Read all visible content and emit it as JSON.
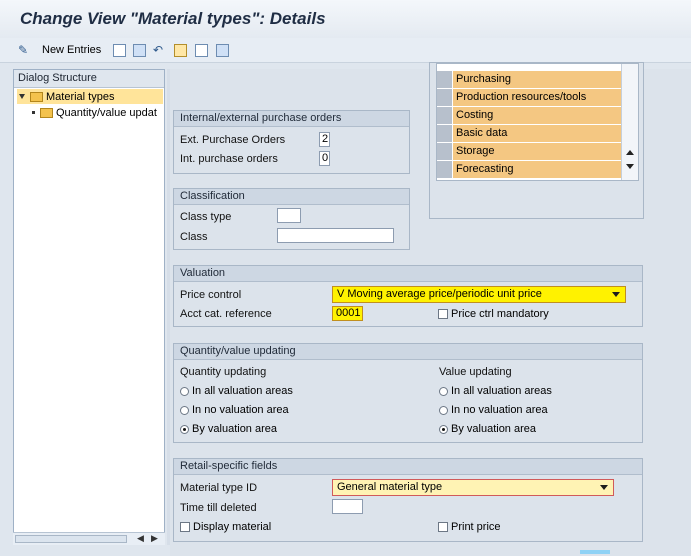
{
  "window": {
    "title": "Change View \"Material types\": Details"
  },
  "toolbar": {
    "new_entries_label": "New Entries"
  },
  "dialog_structure": {
    "header": "Dialog Structure",
    "items": [
      {
        "label": "Material types",
        "selected": true
      },
      {
        "label": "Quantity/value updat",
        "selected": false
      }
    ]
  },
  "views_list": {
    "items": [
      "Purchasing",
      "Production resources/tools",
      "Costing",
      "Basic data",
      "Storage",
      "Forecasting"
    ]
  },
  "purchase_orders": {
    "title": "Internal/external purchase orders",
    "ext_label": "Ext. Purchase Orders",
    "ext_value": "2",
    "int_label": "Int. purchase orders",
    "int_value": "0"
  },
  "classification": {
    "title": "Classification",
    "class_type_label": "Class type",
    "class_type_value": "",
    "class_label": "Class",
    "class_value": ""
  },
  "valuation": {
    "title": "Valuation",
    "price_control_label": "Price control",
    "price_control_value": "V Moving average price/periodic unit price",
    "acct_cat_label": "Acct cat. reference",
    "acct_cat_value": "0001",
    "price_ctrl_mandatory_label": "Price ctrl mandatory"
  },
  "qty_value_updating": {
    "title": "Quantity/value updating",
    "quantity_header": "Quantity updating",
    "value_header": "Value updating",
    "options": [
      "In all valuation areas",
      "In no valuation area",
      "By valuation area"
    ],
    "quantity_selected": 2,
    "value_selected": 2
  },
  "retail": {
    "title": "Retail-specific fields",
    "material_type_id_label": "Material type ID",
    "material_type_id_value": "General material type",
    "time_till_deleted_label": "Time till deleted",
    "time_till_deleted_value": "",
    "display_material_label": "Display material",
    "print_price_label": "Print price"
  },
  "colors": {
    "highlight": "#fff200",
    "selected_row": "#f4c782",
    "dropdown_bg": "#fff3b4"
  }
}
